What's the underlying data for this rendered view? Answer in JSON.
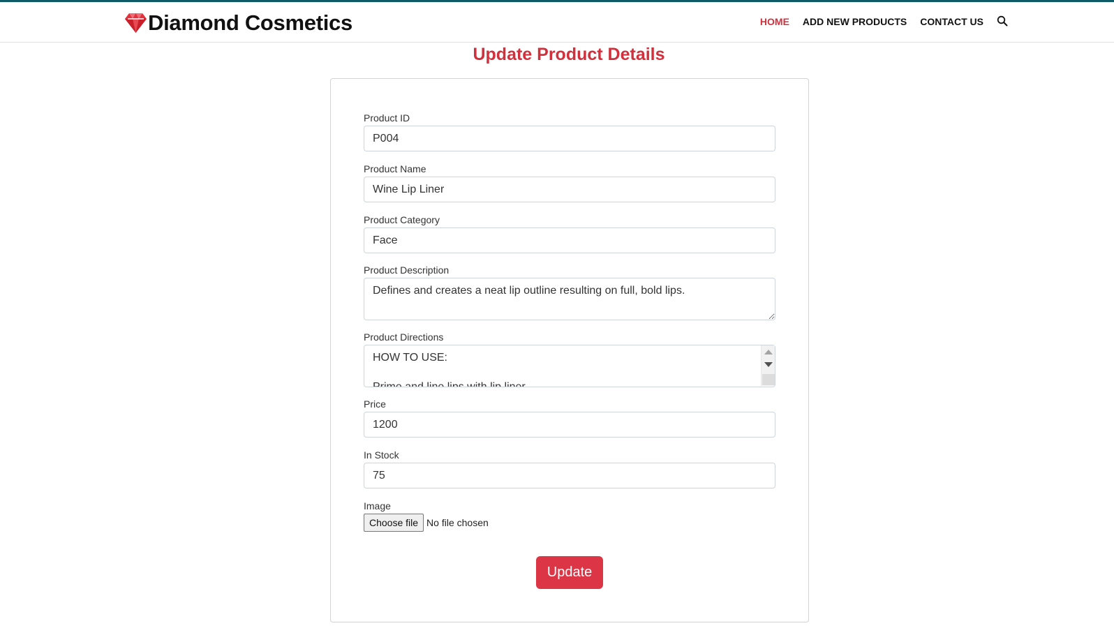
{
  "brand": {
    "name": "Diamond Cosmetics",
    "logo_icon": "diamond-icon",
    "logo_color": "#e0313c"
  },
  "nav": {
    "items": [
      {
        "label": "HOME",
        "active": true
      },
      {
        "label": "ADD NEW PRODUCTS",
        "active": false
      },
      {
        "label": "CONTACT US",
        "active": false
      }
    ],
    "search_icon": "search-icon"
  },
  "page": {
    "title": "Update Product Details"
  },
  "form": {
    "product_id": {
      "label": "Product ID",
      "value": "P004"
    },
    "product_name": {
      "label": "Product Name",
      "value": "Wine Lip Liner"
    },
    "product_category": {
      "label": "Product Category",
      "value": "Face"
    },
    "product_description": {
      "label": "Product Description",
      "value": "Defines and creates a neat lip outline resulting on full, bold lips."
    },
    "product_directions": {
      "label": "Product Directions",
      "value": "HOW TO USE:\n\nPrime and line lips with lip liner."
    },
    "price": {
      "label": "Price",
      "value": "1200"
    },
    "in_stock": {
      "label": "In Stock",
      "value": "75"
    },
    "image": {
      "label": "Image",
      "button_label": "Choose file",
      "status": "No file chosen"
    },
    "submit_label": "Update"
  },
  "colors": {
    "accent": "#d0313c",
    "button": "#dc3545",
    "topline": "#0e5a66"
  }
}
